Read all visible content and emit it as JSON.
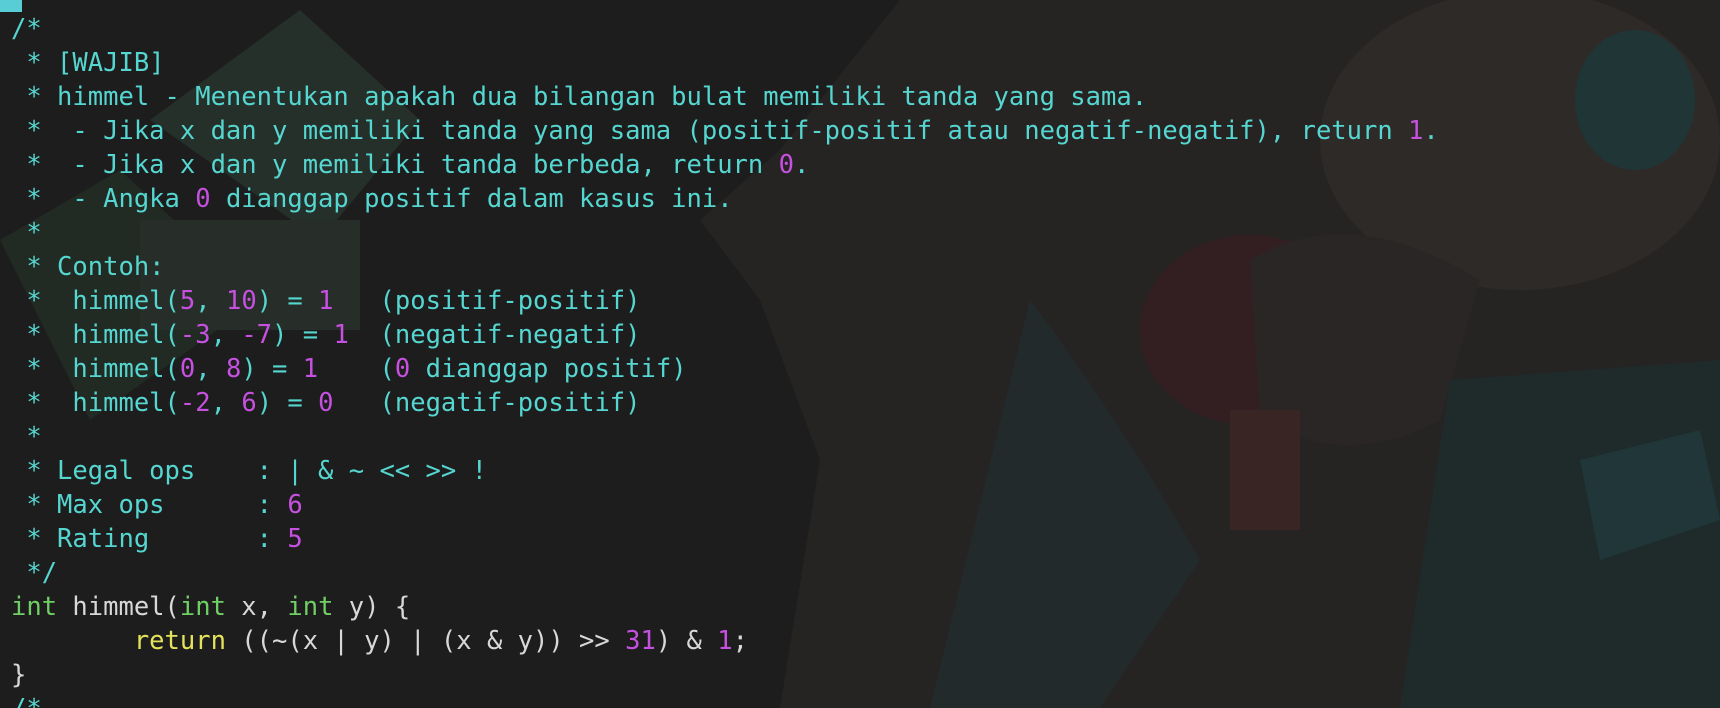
{
  "editor": {
    "lines": [
      [
        {
          "t": "/*",
          "c": "cmt"
        }
      ],
      [
        {
          "t": " * [WAJIB]",
          "c": "cmt"
        }
      ],
      [
        {
          "t": " * himmel - Menentukan apakah dua bilangan bulat memiliki tanda yang sama.",
          "c": "cmt"
        }
      ],
      [
        {
          "t": " *  - Jika x dan y memiliki tanda yang sama (positif-positif atau negatif-negatif), return ",
          "c": "cmt"
        },
        {
          "t": "1",
          "c": "num"
        },
        {
          "t": ".",
          "c": "cmt"
        }
      ],
      [
        {
          "t": " *  - Jika x dan y memiliki tanda berbeda, return ",
          "c": "cmt"
        },
        {
          "t": "0",
          "c": "num"
        },
        {
          "t": ".",
          "c": "cmt"
        }
      ],
      [
        {
          "t": " *  - Angka ",
          "c": "cmt"
        },
        {
          "t": "0",
          "c": "num"
        },
        {
          "t": " dianggap positif dalam kasus ini.",
          "c": "cmt"
        }
      ],
      [
        {
          "t": " *",
          "c": "cmt"
        }
      ],
      [
        {
          "t": " * Contoh:",
          "c": "cmt"
        }
      ],
      [
        {
          "t": " *  himmel(",
          "c": "cmt"
        },
        {
          "t": "5",
          "c": "num"
        },
        {
          "t": ", ",
          "c": "cmt"
        },
        {
          "t": "10",
          "c": "num"
        },
        {
          "t": ") = ",
          "c": "cmt"
        },
        {
          "t": "1",
          "c": "num"
        },
        {
          "t": "   (positif-positif)",
          "c": "cmt"
        }
      ],
      [
        {
          "t": " *  himmel(",
          "c": "cmt"
        },
        {
          "t": "-3",
          "c": "num"
        },
        {
          "t": ", ",
          "c": "cmt"
        },
        {
          "t": "-7",
          "c": "num"
        },
        {
          "t": ") = ",
          "c": "cmt"
        },
        {
          "t": "1",
          "c": "num"
        },
        {
          "t": "  (negatif-negatif)",
          "c": "cmt"
        }
      ],
      [
        {
          "t": " *  himmel(",
          "c": "cmt"
        },
        {
          "t": "0",
          "c": "num"
        },
        {
          "t": ", ",
          "c": "cmt"
        },
        {
          "t": "8",
          "c": "num"
        },
        {
          "t": ") = ",
          "c": "cmt"
        },
        {
          "t": "1",
          "c": "num"
        },
        {
          "t": "    (",
          "c": "cmt"
        },
        {
          "t": "0",
          "c": "num"
        },
        {
          "t": " dianggap positif)",
          "c": "cmt"
        }
      ],
      [
        {
          "t": " *  himmel(",
          "c": "cmt"
        },
        {
          "t": "-2",
          "c": "num"
        },
        {
          "t": ", ",
          "c": "cmt"
        },
        {
          "t": "6",
          "c": "num"
        },
        {
          "t": ") = ",
          "c": "cmt"
        },
        {
          "t": "0",
          "c": "num"
        },
        {
          "t": "   (negatif-positif)",
          "c": "cmt"
        }
      ],
      [
        {
          "t": " *",
          "c": "cmt"
        }
      ],
      [
        {
          "t": " * Legal ops    : | & ~ << >> !",
          "c": "cmt"
        }
      ],
      [
        {
          "t": " * Max ops      : ",
          "c": "cmt"
        },
        {
          "t": "6",
          "c": "num"
        }
      ],
      [
        {
          "t": " * Rating       : ",
          "c": "cmt"
        },
        {
          "t": "5",
          "c": "num"
        }
      ],
      [
        {
          "t": " */",
          "c": "cmt"
        }
      ],
      [
        {
          "t": "int",
          "c": "kw-type"
        },
        {
          "t": " himmel(",
          "c": "plain"
        },
        {
          "t": "int",
          "c": "kw-type"
        },
        {
          "t": " x, ",
          "c": "plain"
        },
        {
          "t": "int",
          "c": "kw-type"
        },
        {
          "t": " y) {",
          "c": "plain"
        }
      ],
      [
        {
          "t": "        ",
          "c": "plain"
        },
        {
          "t": "return",
          "c": "kw-ctl"
        },
        {
          "t": " ((~(x | y) | (x & y)) >> ",
          "c": "plain"
        },
        {
          "t": "31",
          "c": "num"
        },
        {
          "t": ") & ",
          "c": "plain"
        },
        {
          "t": "1",
          "c": "num"
        },
        {
          "t": ";",
          "c": "plain"
        }
      ],
      [
        {
          "t": "}",
          "c": "plain"
        }
      ],
      [
        {
          "t": "/*",
          "c": "cmt"
        }
      ]
    ]
  },
  "colors": {
    "background": "#1d1d1d",
    "comment": "#56d6d0",
    "number": "#c650e0",
    "type_keyword": "#6fcf64",
    "control_keyword": "#e4e25a",
    "plain_text": "#d8d8d8",
    "cursor": "#58cdd6"
  }
}
